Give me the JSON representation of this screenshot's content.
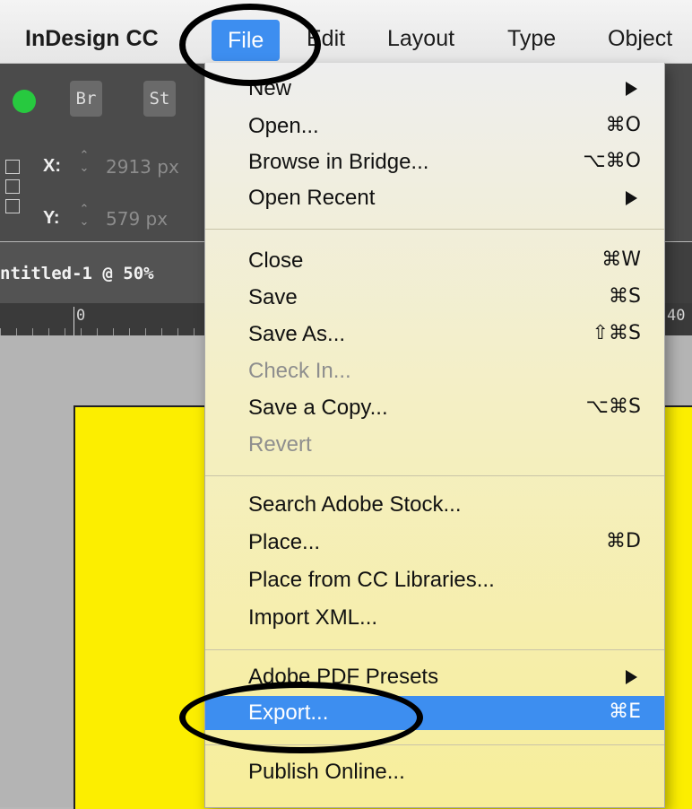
{
  "menubar": {
    "app_name": "InDesign CC",
    "items": [
      "File",
      "Edit",
      "Layout",
      "Type",
      "Object"
    ]
  },
  "toolbar": {
    "bridge_button": "Br",
    "stock_button": "St",
    "x_label": "X:",
    "x_value": "2913 px",
    "y_label": "Y:",
    "y_value": "579 px"
  },
  "document": {
    "tab_label": "ntitled-1 @ 50%",
    "ruler_start": "0",
    "ruler_mark": "40"
  },
  "file_menu": {
    "items": [
      {
        "label": "New",
        "shortcut": "",
        "submenu": true
      },
      {
        "label": "Open...",
        "shortcut": "⌘O"
      },
      {
        "label": "Browse in Bridge...",
        "shortcut": "⌥⌘O"
      },
      {
        "label": "Open Recent",
        "shortcut": "",
        "submenu": true
      },
      {
        "label": "Close",
        "shortcut": "⌘W"
      },
      {
        "label": "Save",
        "shortcut": "⌘S"
      },
      {
        "label": "Save As...",
        "shortcut": "⇧⌘S"
      },
      {
        "label": "Check In...",
        "shortcut": "",
        "disabled": true
      },
      {
        "label": "Save a Copy...",
        "shortcut": "⌥⌘S"
      },
      {
        "label": "Revert",
        "shortcut": "",
        "disabled": true
      },
      {
        "label": "Search Adobe Stock...",
        "shortcut": ""
      },
      {
        "label": "Place...",
        "shortcut": "⌘D"
      },
      {
        "label": "Place from CC Libraries...",
        "shortcut": ""
      },
      {
        "label": "Import XML...",
        "shortcut": ""
      },
      {
        "label": "Adobe PDF Presets",
        "shortcut": "",
        "submenu": true
      },
      {
        "label": "Export...",
        "shortcut": "⌘E",
        "highlighted": true
      },
      {
        "label": "Publish Online...",
        "shortcut": ""
      }
    ]
  },
  "colors": {
    "menu_highlight": "#3d8ef0",
    "page_fill": "#fcee00",
    "app_chrome": "#4b4b4b",
    "traffic_light_green": "#27c93f"
  }
}
